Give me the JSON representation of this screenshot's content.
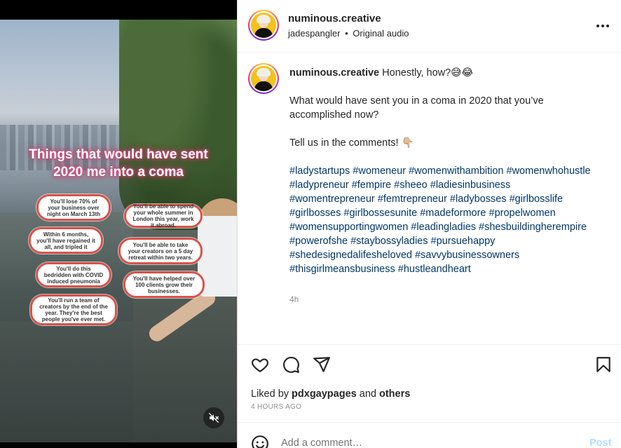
{
  "video": {
    "title_line1": "Things that would have sent",
    "title_line2": "2020 me into a coma",
    "bubbles": [
      "You'll lose 70% of your business over night on March 13th",
      "Within 6 months, you'll have regained it all, and tripled it",
      "You'll do this bedridden with COVID induced pneumonia",
      "You'll run a team of creators by the end of the year. They're the best people you've ever met.",
      "You'll be able to spend your whole summer in London this year, work it abroad.",
      "You'll be able to take your creators on a 5 day retreat within two years.",
      "You'll have helped over 100 clients grow their businesses."
    ],
    "mute_icon": "speaker-muted-icon"
  },
  "header": {
    "username": "numinous.creative",
    "audio_user": "jadespangler",
    "separator": "•",
    "audio_label": "Original audio",
    "more_icon": "more-horizontal-icon"
  },
  "caption": {
    "username": "numinous.creative",
    "line1": "Honestly, how?😅😂",
    "line2": "What would have sent you in a coma in 2020 that you’ve accomplished now?",
    "line3": "Tell us in the comments! 👇🏼",
    "hashtags": [
      "#ladystartups",
      "#womeneur",
      "#womenwithambition",
      "#womenwhohustle",
      "#ladypreneur",
      "#fempire",
      "#sheeo",
      "#ladiesinbusiness",
      "#womentrepreneur",
      "#femtrepreneur",
      "#ladybosses",
      "#girlbosslife",
      "#girlbosses",
      "#girlbossesunite",
      "#madeformore",
      "#propelwomen",
      "#womensupportingwomen",
      "#leadingladies",
      "#shesbuildingherempire",
      "#powerofshe",
      "#staybossyladies",
      "#pursuehappy",
      "#shedesignedalifesheloved",
      "#savvybusinessowners",
      "#thisgirlmeansbusiness",
      "#hustleandheart"
    ],
    "time_short": "4h"
  },
  "actions": {
    "like_icon": "heart-icon",
    "comment_icon": "comment-icon",
    "share_icon": "share-icon",
    "save_icon": "bookmark-icon"
  },
  "likes": {
    "prefix": "Liked by",
    "user": "pdxgaypages",
    "middle": "and",
    "others": "others"
  },
  "post_time": "4 HOURS AGO",
  "comment": {
    "placeholder": "Add a comment…",
    "post_label": "Post",
    "emoji_icon": "smiley-icon"
  },
  "colors": {
    "link": "#00376b",
    "post_disabled": "#b2dffc",
    "muted_text": "#8e8e8e",
    "bubble_border": "#d9524a",
    "title_glow": "#d8477a"
  }
}
